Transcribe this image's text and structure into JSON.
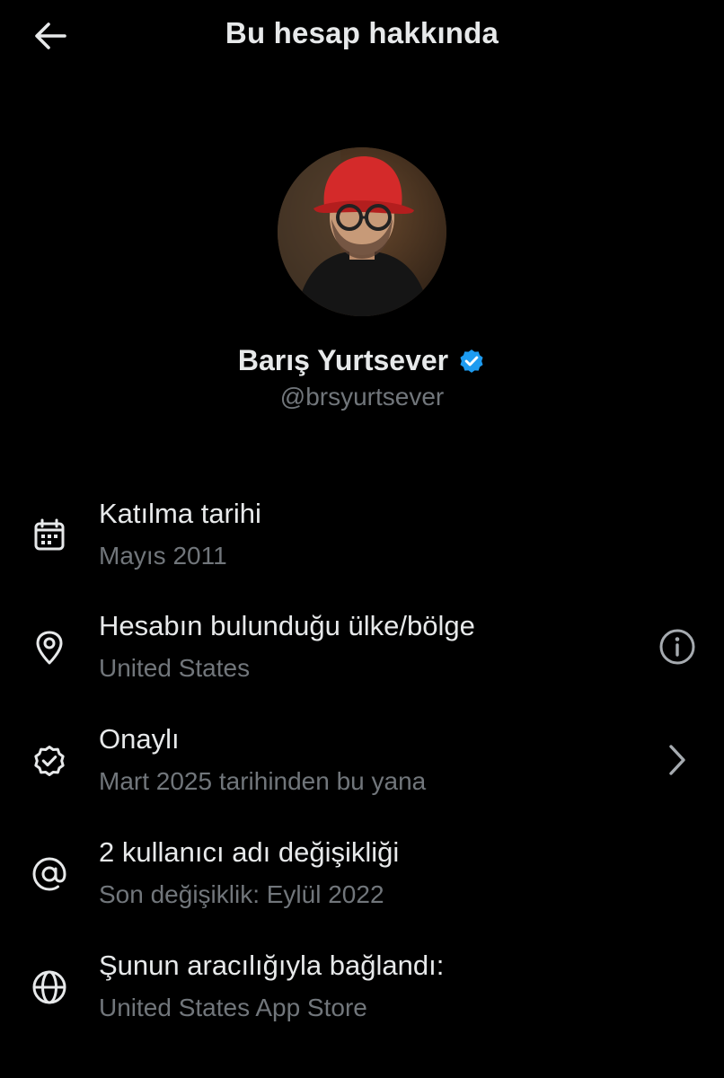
{
  "header": {
    "title": "Bu hesap hakkında",
    "back_icon": "arrow-left-icon"
  },
  "profile": {
    "display_name": "Barış Yurtsever",
    "handle": "@brsyurtsever",
    "verified_badge_color": "#1d9bf0",
    "avatar_icon": "profile-photo"
  },
  "rows": [
    {
      "icon": "calendar-icon",
      "title": "Katılma tarihi",
      "subtitle": "Mayıs 2011"
    },
    {
      "icon": "location-pin-icon",
      "title": "Hesabın bulunduğu ülke/bölge",
      "subtitle": "United States",
      "trailing_icon": "info-icon"
    },
    {
      "icon": "verified-badge-icon",
      "title": "Onaylı",
      "subtitle": "Mart 2025 tarihinden bu yana",
      "trailing_icon": "chevron-right-icon"
    },
    {
      "icon": "at-sign-icon",
      "title": "2 kullanıcı adı değişikliği",
      "subtitle": "Son değişiklik: Eylül 2022"
    },
    {
      "icon": "globe-icon",
      "title": "Şunun aracılığıyla bağlandı:",
      "subtitle": "United States App Store"
    }
  ],
  "colors": {
    "background": "#000000",
    "primary_text": "#e7e9ea",
    "secondary_text": "#71767b",
    "accent": "#1d9bf0"
  }
}
